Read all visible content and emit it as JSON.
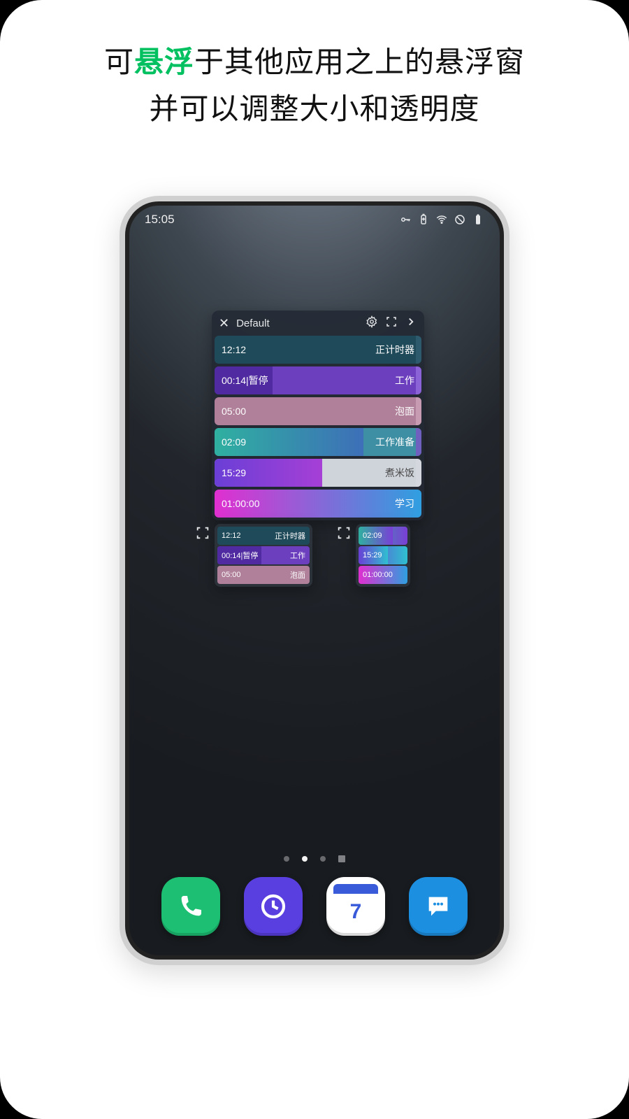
{
  "promo": {
    "line1_pre": "可",
    "line1_accent": "悬浮",
    "line1_post": "于其他应用之上的悬浮窗",
    "line2": "并可以调整大小和透明度"
  },
  "status": {
    "time": "15:05"
  },
  "window": {
    "title": "Default",
    "rows": [
      {
        "time": "12:12",
        "label": "正计时器",
        "bg": "#1f4a5a",
        "progress_bg": "#163c4a",
        "progress": 0.0,
        "edge": "#2d5a6c"
      },
      {
        "time": "00:14|暂停",
        "label": "工作",
        "bg": "#6c3fbf",
        "progress_bg": "#4f2aa0",
        "progress": 0.28,
        "edge": "#8b63d6"
      },
      {
        "time": "05:00",
        "label": "泡面",
        "bg": "#b07f99",
        "progress_bg": "#b07f99",
        "progress": 0.0,
        "edge": "#c79cb3"
      },
      {
        "time": "02:09",
        "label": "工作准备",
        "bg": "#3e8fa3",
        "progress_bg": "linear-gradient(90deg,#2fb0a0,#3d6fb8)",
        "progress": 0.72,
        "edge": "#6f5fbf"
      },
      {
        "time": "15:29",
        "label": "煮米饭",
        "bg": "#cfd3da",
        "progress_bg": "linear-gradient(90deg,#6a3fd6,#a63fd6)",
        "progress": 0.52,
        "edge": "#d4d8de",
        "dark_label": true
      },
      {
        "time": "01:00:00",
        "label": "学习",
        "bg": "linear-gradient(90deg,#e02fd0,#2f9fe0)",
        "progress_bg": "",
        "progress": 0.0,
        "edge": ""
      }
    ]
  },
  "miniA": {
    "rows": [
      {
        "time": "12:12",
        "label": "正计时器",
        "bg": "#1f4a5a"
      },
      {
        "time": "00:14|暂停",
        "label": "工作",
        "bg": "#6c3fbf",
        "progress_bg": "#4f2aa0",
        "progress": 0.48
      },
      {
        "time": "05:00",
        "label": "泡面",
        "bg": "#b07f99"
      }
    ]
  },
  "miniB": {
    "rows": [
      {
        "time": "02:09",
        "label": "",
        "bg": "linear-gradient(90deg,#2fb0a0,#7a3fd6)",
        "progress": 0.7
      },
      {
        "time": "15:29",
        "label": "",
        "bg": "linear-gradient(90deg,#6a3fd6,#2fc0d0)",
        "progress": 0.6
      },
      {
        "time": "01:00:00",
        "label": "",
        "bg": "linear-gradient(90deg,#e02fd0,#2f9fe0)"
      }
    ]
  },
  "dock": {
    "apps": [
      {
        "name": "phone",
        "color": "#1dbf73"
      },
      {
        "name": "clock",
        "color": "#5a3fe0"
      },
      {
        "name": "calendar",
        "color": "#3a5bd9",
        "day": "7"
      },
      {
        "name": "messages",
        "color": "#1d8fe0"
      }
    ]
  }
}
